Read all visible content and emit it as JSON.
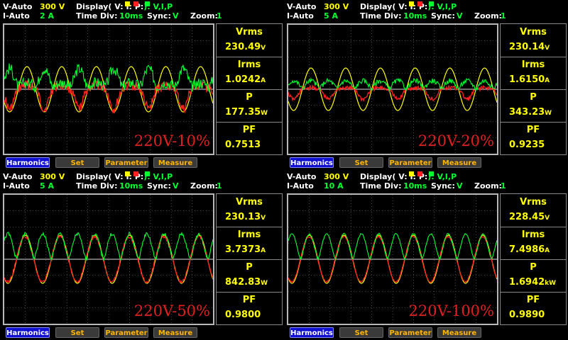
{
  "labels": {
    "display_prefix": "Display( V:",
    "i_sep": "I:",
    "p_sep": "P:",
    "display_suffix": "): V,I,P",
    "time_div": "Time  Div:",
    "sync": "Sync:",
    "zoom": "Zoom:",
    "vrms": "Vrms",
    "irms": "Irms",
    "p": "P",
    "pf": "PF"
  },
  "colors": {
    "voltage": "#ffff00",
    "current": "#ff2020",
    "power": "#00ff33",
    "grid": "#7a7a7a"
  },
  "buttons": [
    "Harmonics",
    "Set",
    "Parameter",
    "Measure"
  ],
  "panels": [
    {
      "v_mode": "V-Auto",
      "v_range": "300  V",
      "i_mode": "I-Auto",
      "i_range": "2  A",
      "time_div": "10ms",
      "sync": "V",
      "zoom": "1",
      "vrms": "230.49",
      "vrms_unit": "V",
      "irms": "1.0242",
      "irms_unit": "A",
      "p": "177.35",
      "p_unit": "W",
      "pf": "0.7513",
      "tag": "220V-10%"
    },
    {
      "v_mode": "V-Auto",
      "v_range": "300  V",
      "i_mode": "I-Auto",
      "i_range": "5  A",
      "time_div": "10ms",
      "sync": "V",
      "zoom": "1",
      "vrms": "230.14",
      "vrms_unit": "V",
      "irms": "1.6150",
      "irms_unit": "A",
      "p": "343.23",
      "p_unit": "W",
      "pf": "0.9235",
      "tag": "220V-20%"
    },
    {
      "v_mode": "V-Auto",
      "v_range": "300  V",
      "i_mode": "I-Auto",
      "i_range": "5  A",
      "time_div": "10ms",
      "sync": "V",
      "zoom": "1",
      "vrms": "230.13",
      "vrms_unit": "V",
      "irms": "3.7373",
      "irms_unit": "A",
      "p": "842.83",
      "p_unit": "W",
      "pf": "0.9800",
      "tag": "220V-50%"
    },
    {
      "v_mode": "V-Auto",
      "v_range": "300  V",
      "i_mode": "I-Auto",
      "i_range": "10  A",
      "time_div": "10ms",
      "sync": "V",
      "zoom": "1",
      "vrms": "228.45",
      "vrms_unit": "V",
      "irms": "7.4986",
      "irms_unit": "A",
      "p": "1.6942",
      "p_unit": "kW",
      "pf": "0.9890",
      "tag": "220V-100%"
    }
  ]
}
